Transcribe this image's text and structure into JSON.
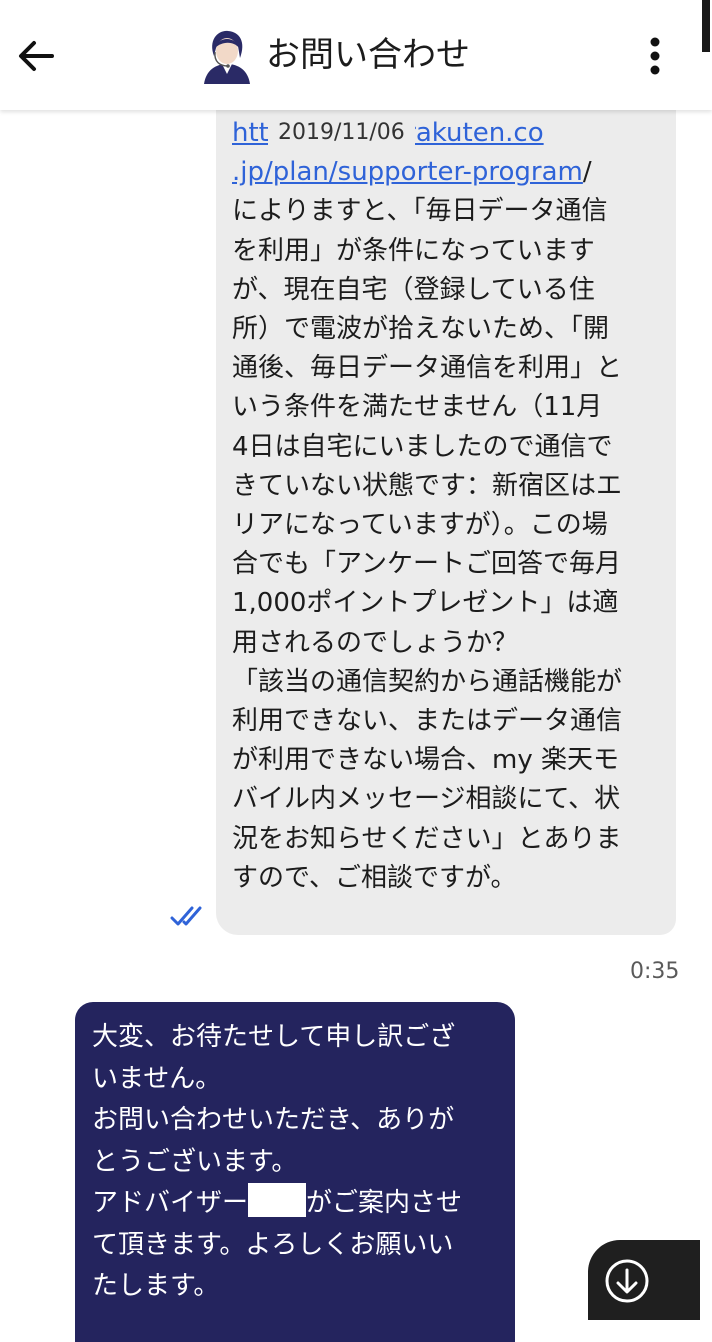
{
  "header": {
    "title": "お問い合わせ",
    "back_icon": "arrow-left-icon",
    "menu_icon": "more-vertical-icon"
  },
  "conversation": {
    "date_chip": "2019/11/06",
    "outgoing_message": {
      "link_prefix": "http",
      "link_visible": "k.mobile.rakuten.co\n.jp/plan/supporter-program",
      "text_after_link": "/\nによりますと、「毎日データ通信\nを利用」が条件になっています\nが、現在自宅（登録している住\n所）で電波が拾えないため、「開\n通後、毎日データ通信を利用」と\nいう条件を満たせません（11月\n4日は自宅にいましたので通信で\nきていない状態です：新宿区はエ\nリアになっていますが）。この場\n合でも「アンケートご回答で毎月\n1,000ポイントプレゼント」は適\n用されるのでしょうか？\n「該当の通信契約から通話機能が\n利用できない、またはデータ通信\nが利用できない場合、my 楽天モ\nバイル内メッセージ相談にて、状\n況をお知らせください」とありま\nすので、ご相談ですが。",
      "status_icon": "double-check-icon",
      "time": "0:35"
    },
    "incoming_message": {
      "part1": "大変、お待たせして申し訳ござ\nいません。\nお問い合わせいただき、ありが\nとうございます。\nアドバイザー",
      "part2": "がご案内させ\nて頂きます。よろしくお願いい\nたします。"
    }
  },
  "scroll_button": {
    "icon": "arrow-down-circle-icon"
  },
  "colors": {
    "outgoing_bubble": "#ececec",
    "incoming_bubble": "#24245e",
    "link": "#2f63d8",
    "read_check": "#2f63d8"
  }
}
